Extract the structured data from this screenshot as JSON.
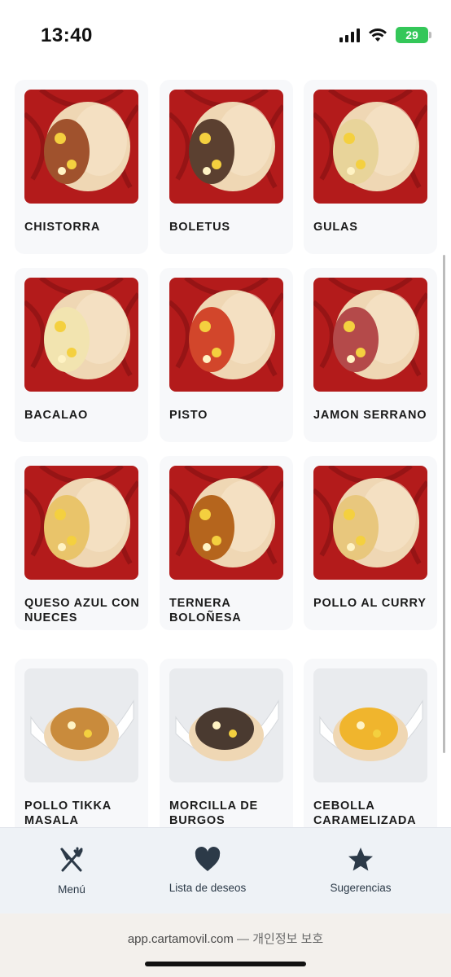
{
  "status": {
    "time": "13:40",
    "battery": "29"
  },
  "items": [
    {
      "name": "CHISTORRA",
      "fill": "#a0522d"
    },
    {
      "name": "BOLETUS",
      "fill": "#5b4030"
    },
    {
      "name": "GULAS",
      "fill": "#e8d49a"
    },
    {
      "name": "BACALAO",
      "fill": "#f2e4b0"
    },
    {
      "name": "PISTO",
      "fill": "#d2462b"
    },
    {
      "name": "JAMON SERRANO",
      "fill": "#b44a4a"
    },
    {
      "name": "QUESO AZUL CON NUECES",
      "fill": "#e9c46a"
    },
    {
      "name": "TERNERA BOLOÑESA",
      "fill": "#b5651d"
    },
    {
      "name": "POLLO AL CURRY",
      "fill": "#e8c77d"
    },
    {
      "name": "POLLO TIKKA MASALA",
      "fill": "#c98b3c"
    },
    {
      "name": "MORCILLA DE BURGOS",
      "fill": "#4a3a30"
    },
    {
      "name": "CEBOLLA CARAMELIZADA",
      "fill": "#f0b52d"
    }
  ],
  "tabs": [
    {
      "label": "Menú",
      "icon": "fork-knife-icon"
    },
    {
      "label": "Lista de deseos",
      "icon": "heart-icon"
    },
    {
      "label": "Sugerencias",
      "icon": "star-icon"
    }
  ],
  "browser": {
    "domain": "app.cartamovil.com",
    "suffix": "— 개인정보 보호"
  },
  "colors": {
    "red_cloth": "#b31b1b",
    "white_bowl": "#e9ebee",
    "bun": "#efd7b4",
    "tab_icon": "#2c3a48"
  }
}
